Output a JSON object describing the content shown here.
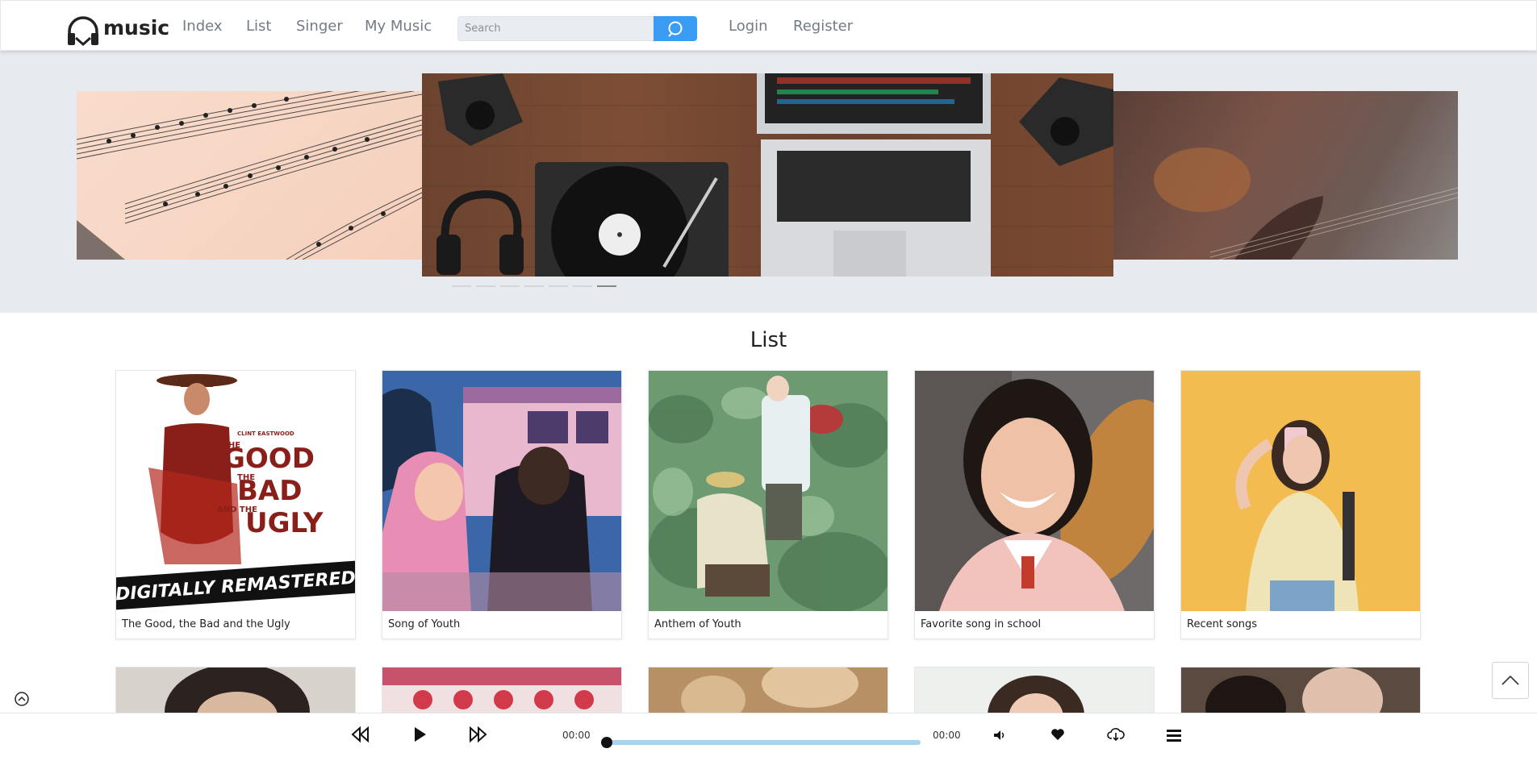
{
  "header": {
    "logo_text": "music",
    "nav": [
      "Index",
      "List",
      "Singer",
      "My Music"
    ],
    "search_placeholder": "Search",
    "auth": [
      "Login",
      "Register"
    ]
  },
  "banner": {
    "slides": [
      "sheet-music-image",
      "turntable-laptop-image",
      "guitar-image"
    ],
    "active_indicator": 4
  },
  "list": {
    "title": "List",
    "items": [
      {
        "label": "The Good, the Bad and the Ugly"
      },
      {
        "label": "Song of Youth"
      },
      {
        "label": "Anthem of Youth"
      },
      {
        "label": "Favorite song in school"
      },
      {
        "label": "Recent songs"
      }
    ],
    "cover_art": {
      "movie_title_lines": [
        "THE",
        "GOOD",
        "THE",
        "BAD",
        "AND THE",
        "UGLY"
      ],
      "movie_actor": "CLINT EASTWOOD",
      "movie_banner": "DIGITALLY REMASTERED"
    }
  },
  "player": {
    "current_time": "00:00",
    "total_time": "00:00",
    "progress": 0
  },
  "colors": {
    "accent": "#3b9cf3",
    "progress": "#a5d4f3",
    "nav_text": "#727b86"
  }
}
